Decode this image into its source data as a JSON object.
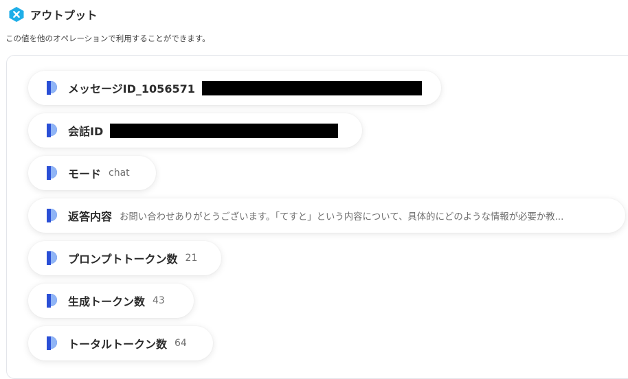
{
  "header": {
    "title": "アウトプット",
    "subtitle": "この値を他のオペレーションで利用することができます。"
  },
  "outputs": [
    {
      "label": "メッセージID_1056571",
      "value": "",
      "redacted": true
    },
    {
      "label": "会話ID",
      "value": "",
      "redacted": true
    },
    {
      "label": "モード",
      "value": "chat"
    },
    {
      "label": "返答内容",
      "value": "お問い合わせありがとうございます。「てすと」という内容について、具体的にどのような情報が必要か教..."
    },
    {
      "label": "プロンプトトークン数",
      "value": "21"
    },
    {
      "label": "生成トークン数",
      "value": "43"
    },
    {
      "label": "トータルトークン数",
      "value": "64"
    }
  ],
  "colors": {
    "logo": "#1eaee8",
    "icon_dark": "#2a4fd6",
    "icon_light": "#8fb4f6"
  }
}
